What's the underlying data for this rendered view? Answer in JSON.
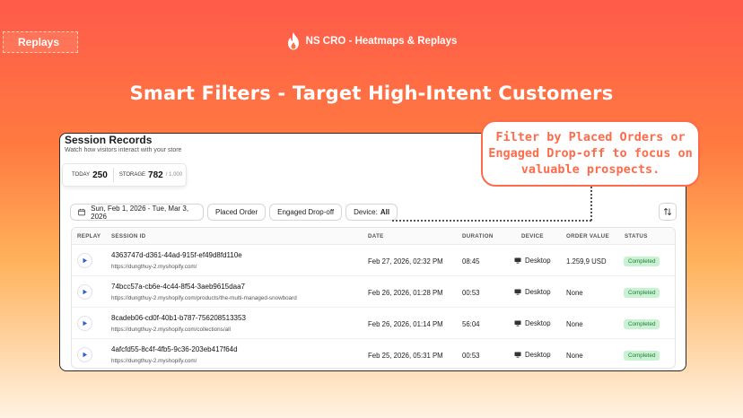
{
  "badge": "Replays",
  "brand": {
    "name": "NS CRO - Heatmaps & Replays",
    "logo_icon": "flame-icon"
  },
  "headline": "Smart Filters - Target High-Intent Customers",
  "callout": "Filter by Placed Orders or Engaged Drop-off to focus on valuable prospects.",
  "card": {
    "title": "Session Records",
    "subtitle": "Watch how visitors interact with your store",
    "stats": {
      "today_label": "TODAY",
      "today_value": "250",
      "storage_label": "STORAGE",
      "storage_value": "782",
      "storage_limit": "/ 1,000"
    },
    "filters": {
      "date_range": "Sun, Feb 1, 2026 - Tue, Mar 3, 2026",
      "placed_order": "Placed Order",
      "engaged_dropoff": "Engaged Drop-off",
      "device_label": "Device:",
      "device_value": "All"
    },
    "columns": [
      "REPLAY",
      "SESSION ID",
      "DATE",
      "DURATION",
      "DEVICE",
      "ORDER VALUE",
      "STATUS"
    ],
    "rows": [
      {
        "id": "4363747d-d361-44ad-915f-ef49d8fd110e",
        "url": "https://dungthuy-2.myshopify.com/",
        "date": "Feb 27, 2026, 02:32 PM",
        "duration": "08:45",
        "device": "Desktop",
        "order_value": "1.259,9 USD",
        "status": "Completed"
      },
      {
        "id": "74bcc57a-cb6e-4c44-8f54-3aeb9615daa7",
        "url": "https://dungthuy-2.myshopify.com/products/the-multi-managed-snowboard",
        "date": "Feb 26, 2026, 01:28 PM",
        "duration": "00:53",
        "device": "Desktop",
        "order_value": "None",
        "status": "Completed"
      },
      {
        "id": "8cadeb06-cd0f-40b1-b787-756208513353",
        "url": "https://dungthuy-2.myshopify.com/collections/all",
        "date": "Feb 26, 2026, 01:14 PM",
        "duration": "56:04",
        "device": "Desktop",
        "order_value": "None",
        "status": "Completed"
      },
      {
        "id": "4afcfd55-8c4f-4fb5-9c36-203eb417f64d",
        "url": "https://dungthuy-2.myshopify.com/",
        "date": "Feb 25, 2026, 05:31 PM",
        "duration": "00:53",
        "device": "Desktop",
        "order_value": "None",
        "status": "Completed"
      }
    ]
  },
  "colors": {
    "accent": "#ff6b4a",
    "play": "#2f5bd3",
    "status_bg": "#c9f2d2",
    "status_text": "#1e7a3a"
  }
}
